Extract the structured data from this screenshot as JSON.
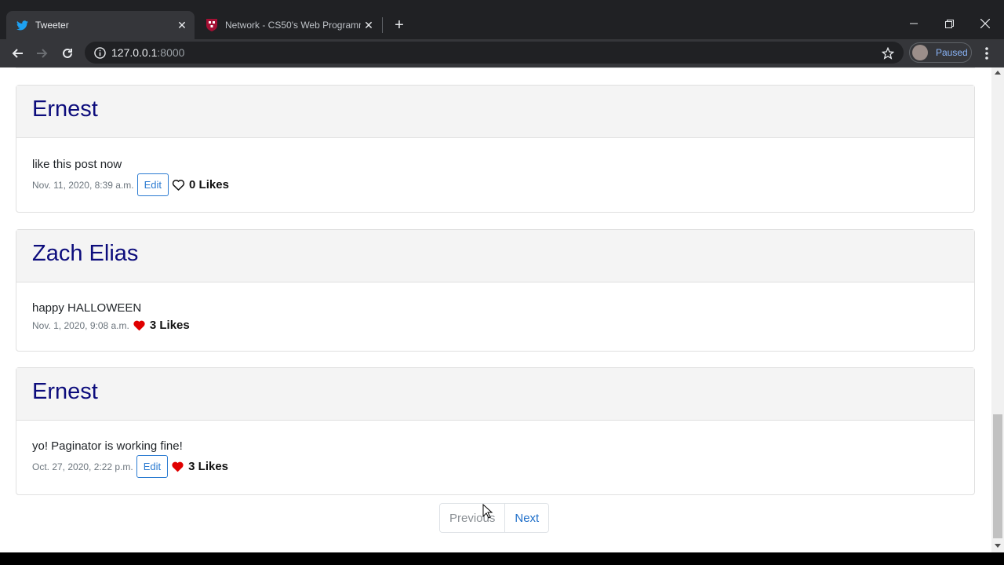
{
  "browser": {
    "tabs": [
      {
        "title": "Tweeter",
        "icon": "twitter-bird-icon",
        "active": true
      },
      {
        "title": "Network - CS50's Web Programm",
        "icon": "harvard-shield-icon",
        "active": false
      }
    ],
    "address": {
      "host": "127.0.0.1",
      "port": ":8000"
    },
    "profile_label": "Paused"
  },
  "posts": [
    {
      "author": "Ernest",
      "content": "like this post now",
      "timestamp": "Nov. 11, 2020, 8:39 a.m.",
      "edit_label": "Edit",
      "liked": false,
      "likes_label": "0 Likes"
    },
    {
      "author": "Zach Elias",
      "content": "happy HALLOWEEN",
      "timestamp": "Nov. 1, 2020, 9:08 a.m.",
      "edit_label": null,
      "liked": true,
      "likes_label": "3 Likes"
    },
    {
      "author": "Ernest",
      "content": "yo! Paginator is working fine!",
      "timestamp": "Oct. 27, 2020, 2:22 p.m.",
      "edit_label": "Edit",
      "liked": true,
      "likes_label": "3 Likes"
    }
  ],
  "pagination": {
    "previous_label": "Previous",
    "next_label": "Next"
  },
  "colors": {
    "author": "#0c0c7c",
    "heart": "#e00000",
    "link": "#1f6fc9"
  }
}
